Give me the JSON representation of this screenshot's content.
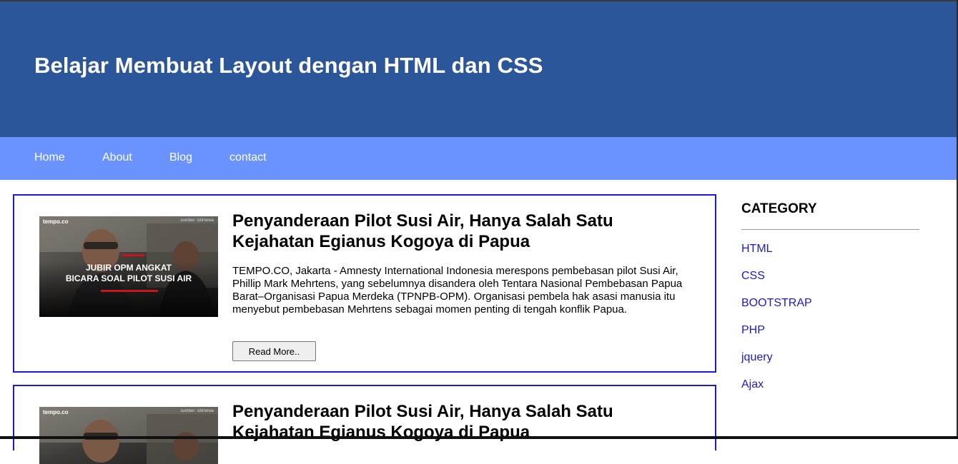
{
  "header": {
    "title": "Belajar Membuat Layout dengan HTML dan CSS"
  },
  "nav": {
    "items": [
      "Home",
      "About",
      "Blog",
      "contact"
    ]
  },
  "articles": [
    {
      "title": "Penyanderaan Pilot Susi Air, Hanya Salah Satu Kejahatan Egianus Kogoya di Papua",
      "excerpt": "TEMPO.CO, Jakarta - Amnesty International Indonesia merespons pembebasan pilot Susi Air, Phillip Mark Mehrtens, yang sebelumnya disandera oleh Tentara Nasional Pembebasan Papua Barat–Organisasi Papua Merdeka (TPNPB-OPM). Organisasi pembela hak asasi manusia itu menyebut pembebasan Mehrtens sebagai momen penting di tengah konflik Papua.",
      "button": "Read More..",
      "thumb": {
        "brand": "tempo.co",
        "credit": "sumber: istimewa",
        "caption_line1": "JUBIR OPM ANGKAT",
        "caption_line2": "BICARA SOAL PILOT SUSI AIR"
      }
    },
    {
      "title": "Penyanderaan Pilot Susi Air, Hanya Salah Satu Kejahatan Egianus Kogoya di Papua",
      "thumb": {
        "brand": "tempo.co",
        "credit": "sumber: istimewa"
      }
    }
  ],
  "sidebar": {
    "heading": "CATEGORY",
    "links": [
      "HTML",
      "CSS",
      "BOOTSTRAP",
      "PHP",
      "jquery",
      "Ajax"
    ]
  },
  "colors": {
    "header_bg": "#2b579a",
    "nav_bg": "#6b93ff",
    "card_border": "#1a1adc",
    "link": "#1a1acc"
  }
}
